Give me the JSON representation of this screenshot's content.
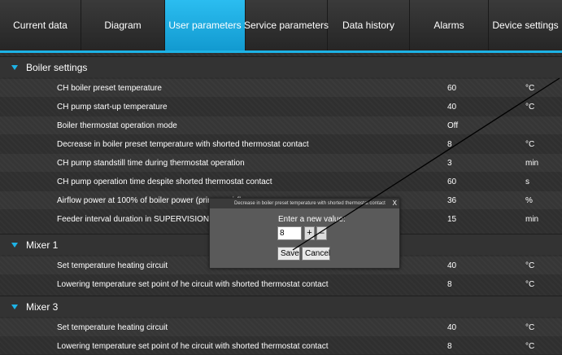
{
  "nav": {
    "tabs": [
      {
        "label": "Current data"
      },
      {
        "label": "Diagram"
      },
      {
        "label": "User parameters"
      },
      {
        "label": "Service parameters"
      },
      {
        "label": "Data history"
      },
      {
        "label": "Alarms"
      },
      {
        "label": "Device settings"
      }
    ],
    "active_tab": "User parameters"
  },
  "sections": [
    {
      "title": "Boiler settings",
      "rows": [
        {
          "name": "CH boiler preset temperature",
          "value": "60",
          "unit": "°C"
        },
        {
          "name": "CH pump start-up temperature",
          "value": "40",
          "unit": "°C"
        },
        {
          "name": "Boiler thermostat operation mode",
          "value": "Off",
          "unit": ""
        },
        {
          "name": "Decrease in boiler preset temperature with shorted thermostat contact",
          "value": "8",
          "unit": "°C"
        },
        {
          "name": "CH pump standstill time during thermostat operation",
          "value": "3",
          "unit": "min"
        },
        {
          "name": "CH pump operation time despite shorted thermostat contact",
          "value": "60",
          "unit": "s"
        },
        {
          "name": "Airflow power at 100% of boiler power (primary airflo",
          "value": "36",
          "unit": "%"
        },
        {
          "name": "Feeder interval duration in SUPERVISION mode",
          "value": "15",
          "unit": "min"
        }
      ]
    },
    {
      "title": "Mixer 1",
      "rows": [
        {
          "name": "Set temperature heating circuit",
          "value": "40",
          "unit": "°C"
        },
        {
          "name": "Lowering temperature set point of he circuit with shorted thermostat contact",
          "value": "8",
          "unit": "°C"
        }
      ]
    },
    {
      "title": "Mixer 3",
      "rows": [
        {
          "name": "Set temperature heating circuit",
          "value": "40",
          "unit": "°C"
        },
        {
          "name": "Lowering temperature set point of he circuit with shorted thermostat contact",
          "value": "8",
          "unit": "°C"
        }
      ]
    }
  ],
  "dialog": {
    "title": "Decrease in boiler preset temperature with shorted thermostat contact",
    "close": "X",
    "prompt": "Enter a new value:",
    "value": "8",
    "plus": "+",
    "minus": "–",
    "save": "Save",
    "cancel": "Cancel"
  },
  "colors": {
    "accent": "#1db3e6",
    "background": "#2f2f2f",
    "text": "#ffffff"
  }
}
